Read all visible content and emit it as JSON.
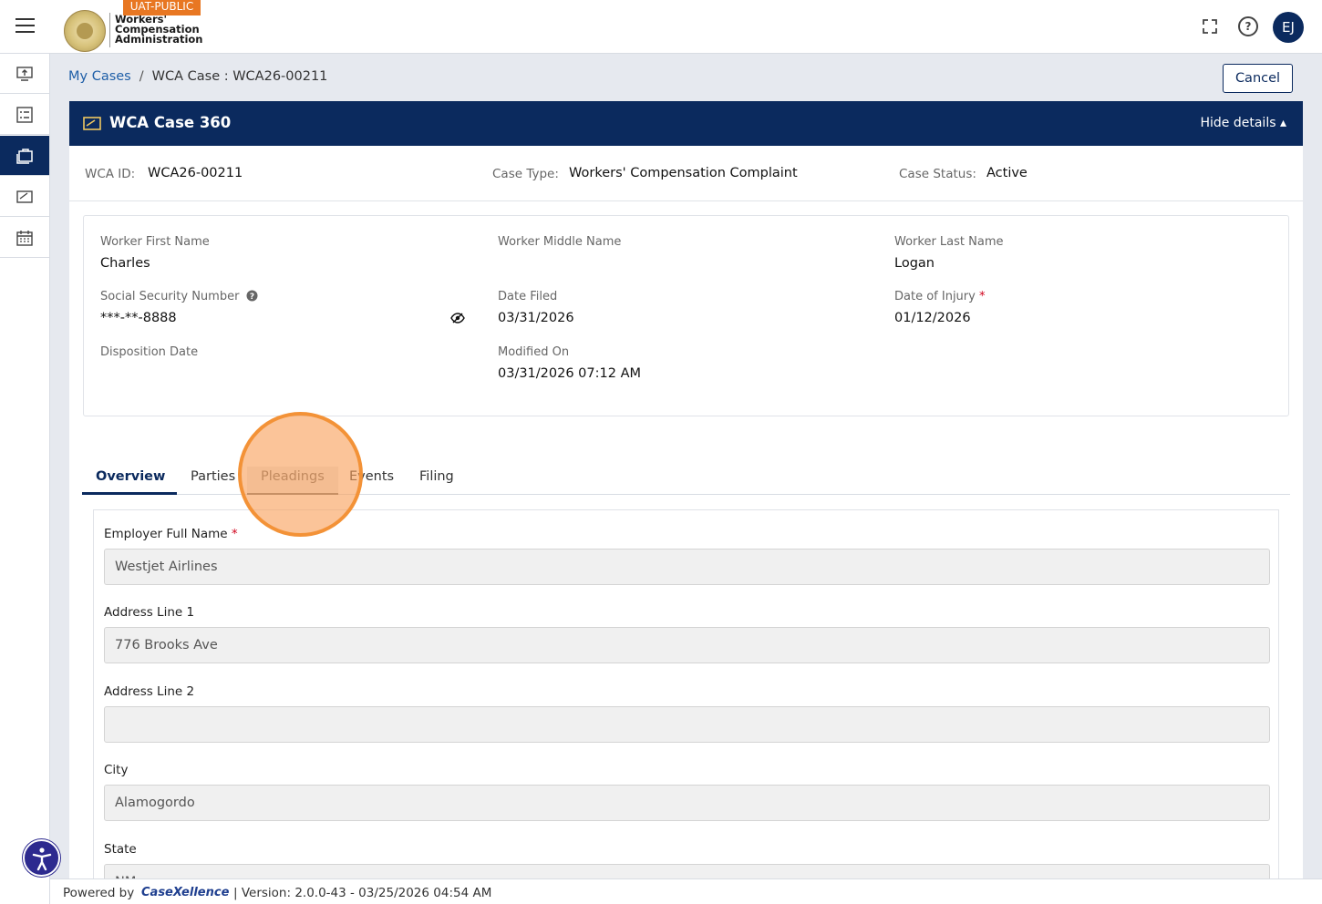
{
  "header": {
    "badge": "UAT-PUBLIC",
    "logo_line1": "Workers'",
    "logo_line2": "Compensation",
    "logo_line3": "Administration",
    "avatar_initials": "EJ"
  },
  "rail": {
    "items": [
      {
        "icon": "upload-icon"
      },
      {
        "icon": "checklist-icon"
      },
      {
        "icon": "briefcase-icon",
        "active": true
      },
      {
        "icon": "document-icon"
      },
      {
        "icon": "calendar-icon"
      }
    ]
  },
  "breadcrumb": {
    "root": "My Cases",
    "separator": "/",
    "current": "WCA Case : WCA26-00211"
  },
  "cancel_label": "Cancel",
  "case": {
    "title": "WCA Case 360",
    "hide_details": "Hide details ▴",
    "id_label": "WCA ID:",
    "id_value": "WCA26-00211",
    "type_label": "Case Type:",
    "type_value": "Workers' Compensation Complaint",
    "status_label": "Case Status:",
    "status_value": "Active"
  },
  "details": {
    "first_name_label": "Worker First Name",
    "first_name": "Charles",
    "middle_name_label": "Worker Middle Name",
    "middle_name": "",
    "last_name_label": "Worker Last Name",
    "last_name": "Logan",
    "ssn_label": "Social Security Number",
    "ssn": "***-**-8888",
    "date_filed_label": "Date Filed",
    "date_filed": "03/31/2026",
    "date_injury_label": "Date of Injury",
    "date_injury": "01/12/2026",
    "disposition_label": "Disposition Date",
    "disposition": "",
    "modified_label": "Modified On",
    "modified": "03/31/2026 07:12 AM",
    "required_mark": "*"
  },
  "tabs": [
    "Overview",
    "Parties",
    "Pleadings",
    "Events",
    "Filing"
  ],
  "form": {
    "employer_label": "Employer Full Name",
    "employer": "Westjet Airlines",
    "address1_label": "Address Line 1",
    "address1": "776 Brooks Ave",
    "address2_label": "Address Line 2",
    "address2": "",
    "city_label": "City",
    "city": "Alamogordo",
    "state_label": "State",
    "state": "NM"
  },
  "footer": {
    "powered_by": "Powered by",
    "brand": "CaseXellence",
    "version": "|  Version: 2.0.0-43 - 03/25/2026 04:54 AM"
  },
  "colors": {
    "navy": "#0b2a5e",
    "link": "#1f5fa8",
    "badge": "#e87722",
    "required": "#d0021b"
  }
}
